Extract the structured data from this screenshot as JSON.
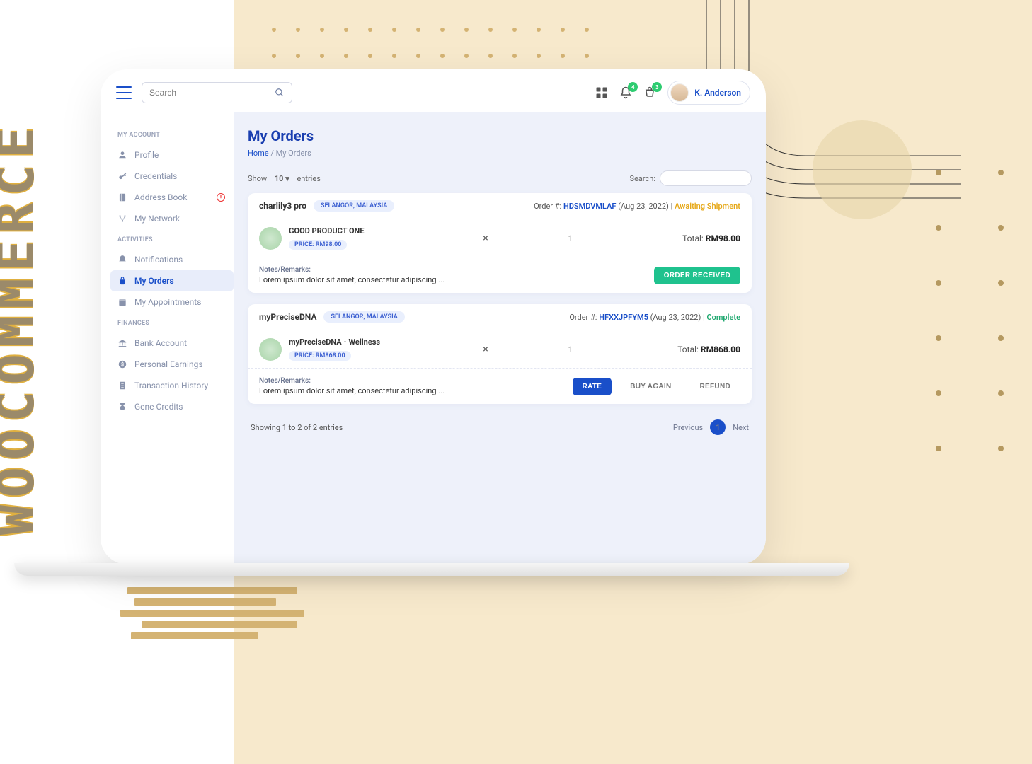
{
  "brand_vertical": "WOOCOMMERCE",
  "topbar": {
    "search_placeholder": "Search",
    "notifications_badge": "4",
    "cart_badge": "3",
    "username": "K. Anderson"
  },
  "sidebar": {
    "section_account": "MY ACCOUNT",
    "profile": "Profile",
    "credentials": "Credentials",
    "address_book": "Address Book",
    "my_network": "My Network",
    "section_activities": "ACTIVITIES",
    "notifications": "Notifications",
    "my_orders": "My Orders",
    "my_appointments": "My Appointments",
    "section_finances": "FINANCES",
    "bank_account": "Bank Account",
    "personal_earnings": "Personal Earnings",
    "transaction_history": "Transaction History",
    "gene_credits": "Gene Credits",
    "address_badge": "!"
  },
  "page": {
    "title": "My Orders",
    "breadcrumb_home": "Home",
    "breadcrumb_sep": " / ",
    "breadcrumb_current": "My Orders"
  },
  "controls": {
    "show_label": "Show",
    "entries_value": "10",
    "entries_label": "entries",
    "search_label": "Search:",
    "caret": "▾"
  },
  "orders": [
    {
      "merchant": "charlily3 pro",
      "location": "SELANGOR, MALAYSIA",
      "order_label": "Order #:",
      "order_id": "HDSMDVMLAF",
      "date": "(Aug 23, 2022)",
      "status": "Awaiting Shipment",
      "status_class": "awaiting",
      "product": "GOOD PRODUCT ONE",
      "price_chip": "PRICE: RM98.00",
      "qty": "1",
      "total_label": "Total:",
      "total_value": "RM98.00",
      "notes_label": "Notes/Remarks:",
      "notes": "Lorem ipsum dolor sit amet, consectetur adipiscing ...",
      "actions": [
        {
          "label": "ORDER RECEIVED",
          "style": "green"
        }
      ]
    },
    {
      "merchant": "myPreciseDNA",
      "location": "SELANGOR, MALAYSIA",
      "order_label": "Order #:",
      "order_id": "HFXXJPFYM5",
      "date": "(Aug 23, 2022)",
      "status": "Complete",
      "status_class": "complete",
      "product": "myPreciseDNA - Wellness",
      "price_chip": "PRICE: RM868.00",
      "qty": "1",
      "total_label": "Total:",
      "total_value": "RM868.00",
      "notes_label": "Notes/Remarks:",
      "notes": "Lorem ipsum dolor sit amet, consectetur adipiscing ...",
      "actions": [
        {
          "label": "RATE",
          "style": "blue"
        },
        {
          "label": "BUY AGAIN",
          "style": "text"
        },
        {
          "label": "REFUND",
          "style": "text"
        }
      ]
    }
  ],
  "pagination": {
    "info": "Showing 1 to 2 of 2 entries",
    "previous": "Previous",
    "page": "1",
    "next": "Next"
  },
  "symbols": {
    "multiply": "×",
    "pipe": " | "
  }
}
